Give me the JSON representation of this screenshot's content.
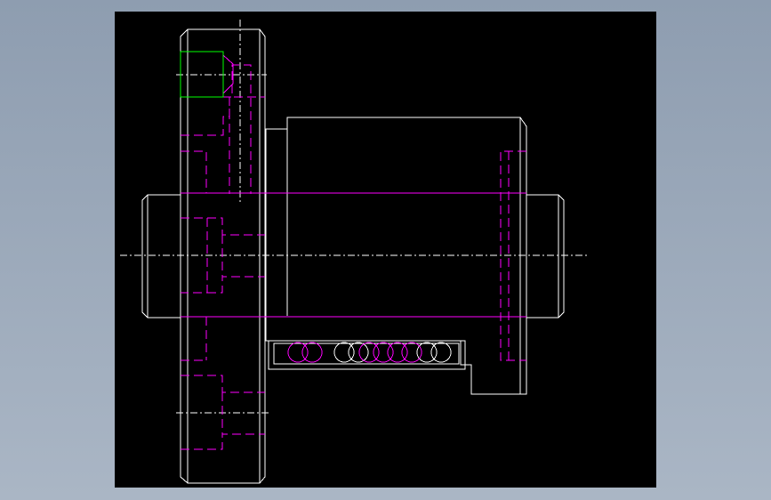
{
  "viewport": {
    "background_gradient": [
      "#8e9db0",
      "#aab6c5"
    ],
    "canvas_color": "#000000"
  },
  "colors": {
    "outline": "#ffffff",
    "hidden": "#ff00ff",
    "highlight": "#00ff00"
  },
  "drawing": {
    "subject": "ball-screw-nut-side-view",
    "line_types": [
      "solid-outline",
      "dashed-hidden",
      "dash-dot-centerline",
      "highlight-box"
    ],
    "balls_visible": 10
  }
}
